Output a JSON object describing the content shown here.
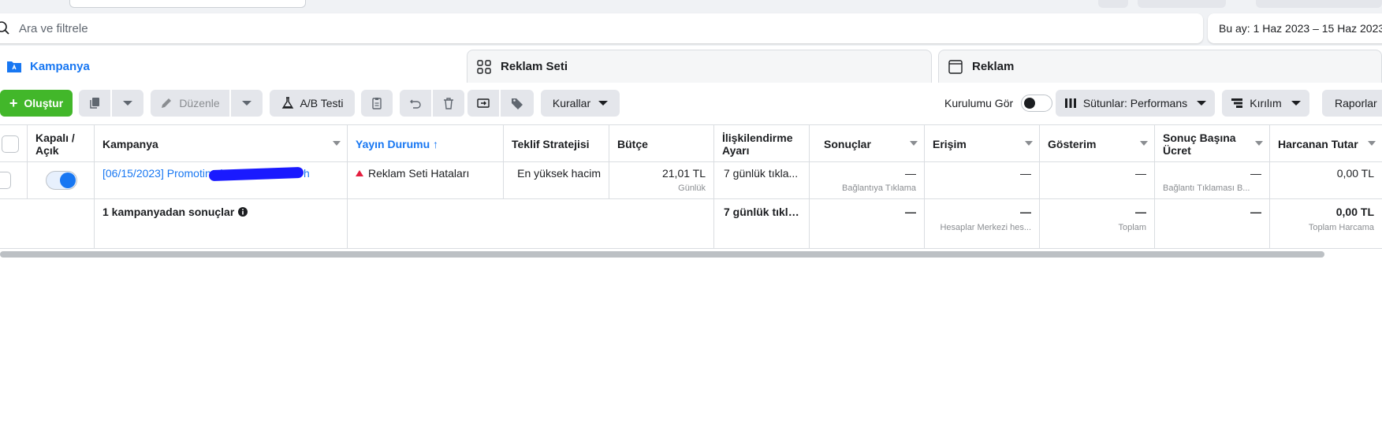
{
  "search": {
    "placeholder": "Ara ve filtrele"
  },
  "date_range": {
    "label": "Bu ay: 1 Haz 2023 – 15 Haz 2023"
  },
  "tabs": [
    {
      "label": "Kampanya",
      "active": true,
      "icon": "folder-icon"
    },
    {
      "label": "Reklam Seti",
      "active": false,
      "icon": "grid-icon"
    },
    {
      "label": "Reklam",
      "active": false,
      "icon": "window-icon"
    }
  ],
  "toolbar": {
    "create_label": "Oluştur",
    "edit_label": "Düzenle",
    "ab_test_label": "A/B Testi",
    "rules_label": "Kurallar",
    "setup_label": "Kurulumu Gör",
    "columns_label": "Sütunlar: Performans",
    "breakdown_label": "Kırılım",
    "reports_label": "Raporlar"
  },
  "table": {
    "headers": {
      "onoff": "Kapalı / Açık",
      "campaign": "Kampanya",
      "delivery": "Yayın Durumu ↑",
      "bid": "Teklif Stratejisi",
      "budget": "Bütçe",
      "attribution": "İlişkilendirme Ayarı",
      "results": "Sonuçlar",
      "reach": "Erişim",
      "impressions": "Gösterim",
      "cpr": "Sonuç Başına Ücret",
      "spent": "Harcanan Tutar"
    },
    "row": {
      "campaign": "[06/15/2023] Promoting htt",
      "campaign_tail": "h",
      "delivery": "Reklam Seti Hataları",
      "bid": "En yüksek hacim",
      "budget": "21,01 TL",
      "budget_sub": "Günlük",
      "attribution": "7 günlük tıkla...",
      "results": "—",
      "results_sub": "Bağlantıya Tıklama",
      "reach": "—",
      "impressions": "—",
      "cpr": "—",
      "cpr_sub": "Bağlantı Tıklaması B...",
      "spent": "0,00 TL"
    },
    "summary": {
      "label": "1 kampanyadan sonuçlar",
      "attribution": "7 günlük tıkla...",
      "results": "—",
      "reach": "—",
      "reach_sub": "Hesaplar Merkezi hes...",
      "impressions": "—",
      "impressions_sub": "Toplam",
      "cpr": "—",
      "spent": "0,00 TL",
      "spent_sub": "Toplam Harcama"
    }
  },
  "colors": {
    "accent": "#1877f2",
    "create": "#42b72a",
    "error": "#e41e3f"
  }
}
